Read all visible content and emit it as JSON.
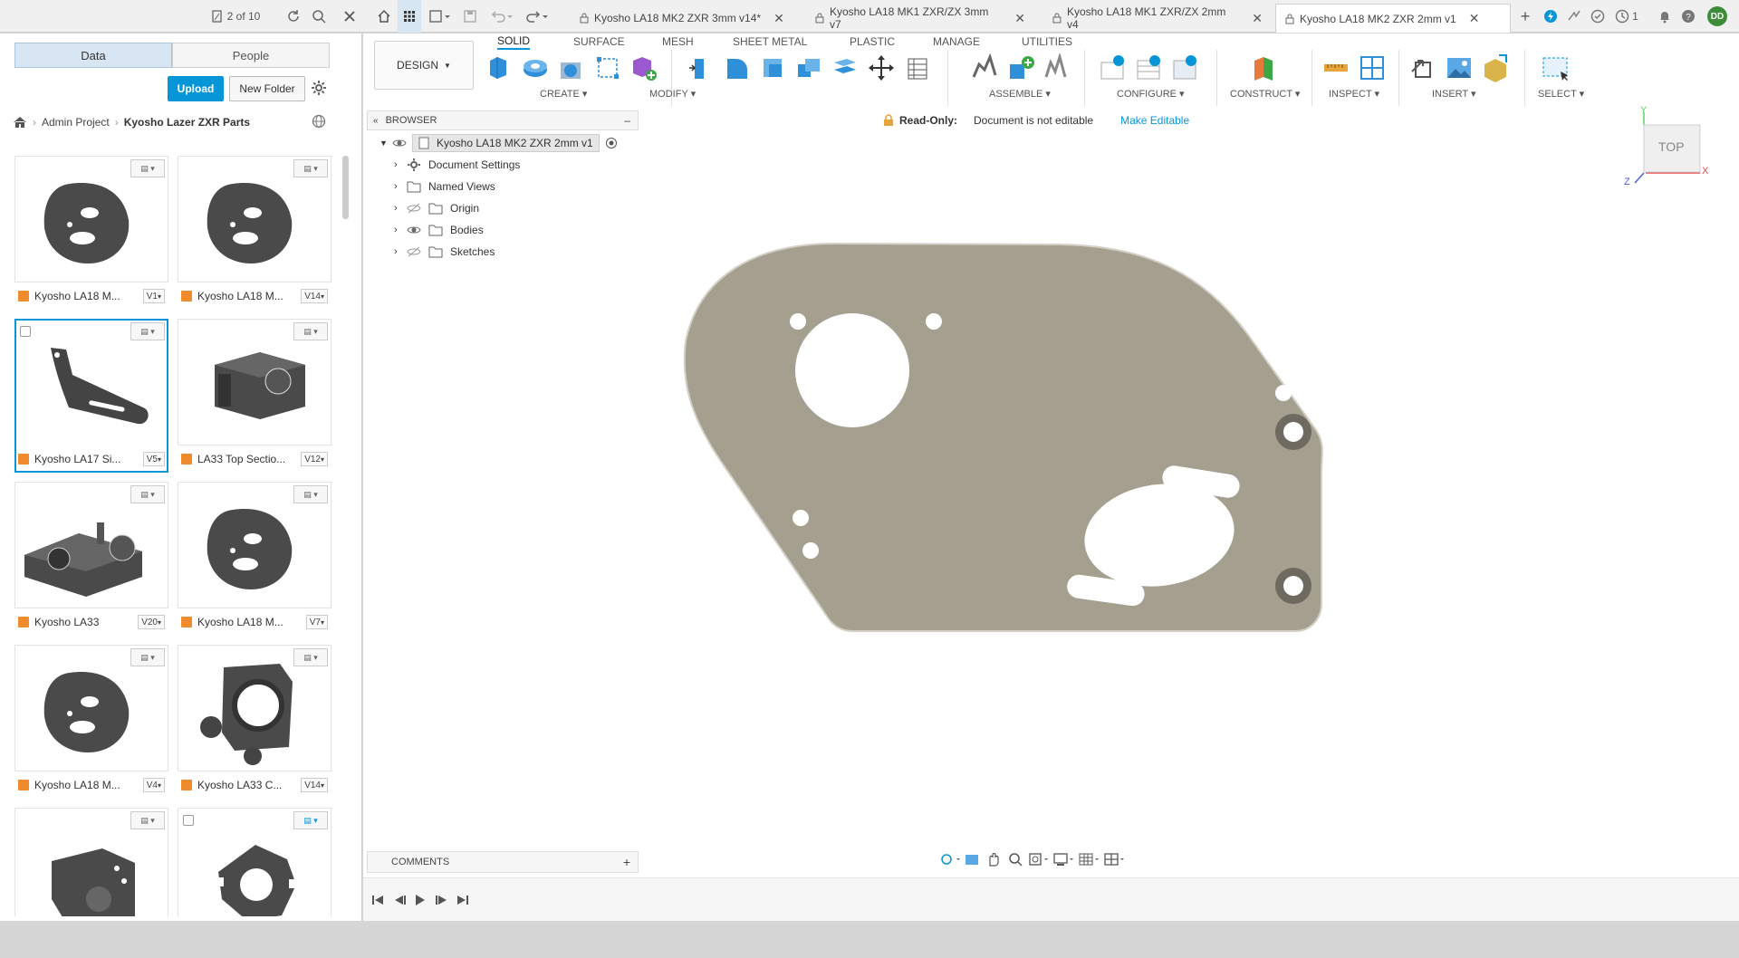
{
  "topbar": {
    "file_counter": "2 of 10",
    "notification_count": "1",
    "user_initials": "DD"
  },
  "doc_tabs": [
    {
      "label": "Kyosho LA18 MK2 ZXR 3mm v14*",
      "active": false
    },
    {
      "label": "Kyosho LA18 MK1 ZXR/ZX 3mm v7",
      "active": false
    },
    {
      "label": "Kyosho LA18 MK1 ZXR/ZX 2mm v4",
      "active": false
    },
    {
      "label": "Kyosho LA18 MK2 ZXR 2mm v1",
      "active": true
    }
  ],
  "data_panel": {
    "tabs": [
      "Data",
      "People"
    ],
    "upload_label": "Upload",
    "new_folder_label": "New Folder",
    "breadcrumb": {
      "project": "Admin Project",
      "folder": "Kyosho Lazer ZXR Parts"
    },
    "files": [
      {
        "name": "Kyosho LA18 M...",
        "version": "V1",
        "shape": "plate",
        "selected": false
      },
      {
        "name": "Kyosho LA18 M...",
        "version": "V14",
        "shape": "plate",
        "selected": false
      },
      {
        "name": "Kyosho LA17 Si...",
        "version": "V5",
        "shape": "arm",
        "selected": true
      },
      {
        "name": "LA33 Top Sectio...",
        "version": "V12",
        "shape": "block",
        "selected": false
      },
      {
        "name": "Kyosho LA33",
        "version": "V20",
        "shape": "housing",
        "selected": false
      },
      {
        "name": "Kyosho LA18 M...",
        "version": "V7",
        "shape": "plate",
        "selected": false
      },
      {
        "name": "Kyosho LA18 M...",
        "version": "V4",
        "shape": "plate",
        "selected": false
      },
      {
        "name": "Kyosho LA33 C...",
        "version": "V14",
        "shape": "mount",
        "selected": false
      },
      {
        "name": "",
        "version": "",
        "shape": "bracket",
        "selected": false
      },
      {
        "name": "",
        "version": "",
        "shape": "ring",
        "selected": false
      }
    ]
  },
  "workspace": {
    "design_label": "DESIGN",
    "tabs": [
      "SOLID",
      "SURFACE",
      "MESH",
      "SHEET METAL",
      "PLASTIC",
      "MANAGE",
      "UTILITIES"
    ],
    "groups": [
      "CREATE",
      "MODIFY",
      "ASSEMBLE",
      "CONFIGURE",
      "CONSTRUCT",
      "INSPECT",
      "INSERT",
      "SELECT"
    ]
  },
  "browser": {
    "title": "BROWSER",
    "root": "Kyosho LA18 MK2 ZXR 2mm v1",
    "items": [
      "Document Settings",
      "Named Views",
      "Origin",
      "Bodies",
      "Sketches"
    ]
  },
  "readonly": {
    "label": "Read-Only:",
    "message": "Document is not editable",
    "action": "Make Editable"
  },
  "viewcube": {
    "face": "TOP",
    "axis_x": "X",
    "axis_y": "Y",
    "axis_z": "Z"
  },
  "comments_label": "COMMENTS",
  "colors": {
    "accent": "#0696d7",
    "part": "#a59f8f",
    "thumb_part": "#4a4a4a",
    "file_cube": "#f08b2d"
  }
}
